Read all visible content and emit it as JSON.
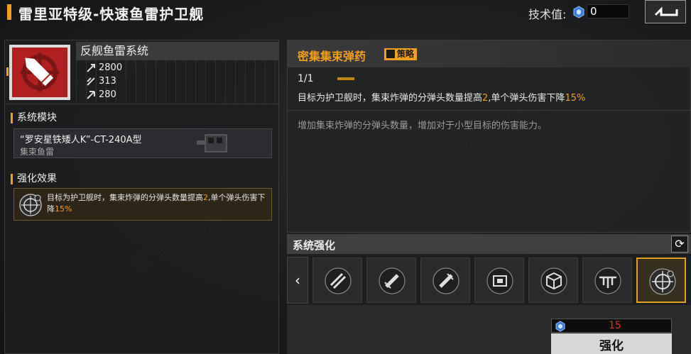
{
  "header": {
    "title": "雷里亚特级-快速鱼雷护卫舰",
    "tech_label": "技术值:",
    "tech_value": "0"
  },
  "weapon": {
    "name": "反舰鱼雷系统",
    "stats": [
      "2800",
      "313",
      "280"
    ]
  },
  "module": {
    "section_label": "系统模块",
    "name": "“罗安星铁矮人K”-CT-240A型",
    "type": "集束鱼雷"
  },
  "effect": {
    "section_label": "强化效果",
    "text_a": "目标为护卫舰时，集束炸弹的分弹头数量提高",
    "hl_a": "2",
    "text_b": ",单个弹头伤害下降",
    "hl_b": "15%"
  },
  "detail": {
    "title": "密集集束弹药",
    "tag": "策略",
    "level": "1/1",
    "desc_a": "目标为护卫舰时，集束炸弹的分弹头数量提高",
    "desc_hl_a": "2",
    "desc_b": ",单个弹头伤害下降",
    "desc_hl_b": "15%",
    "sub": "增加集束炸弹的分弹头数量，增加对于小型目标的伤害能力。"
  },
  "system": {
    "title": "系统强化",
    "slots": [
      "missile-pod-icon",
      "torpedo-icon",
      "torpedo-icon",
      "chip-icon",
      "cube-icon",
      "drone-icon",
      "crosshair-icon"
    ]
  },
  "cost": {
    "value": "15"
  },
  "enhance_label": "强化",
  "watermark": "玩咖宝典",
  "colors": {
    "accent": "#f0a020",
    "cost_red": "#e03030",
    "icon_red": "#b02020"
  }
}
